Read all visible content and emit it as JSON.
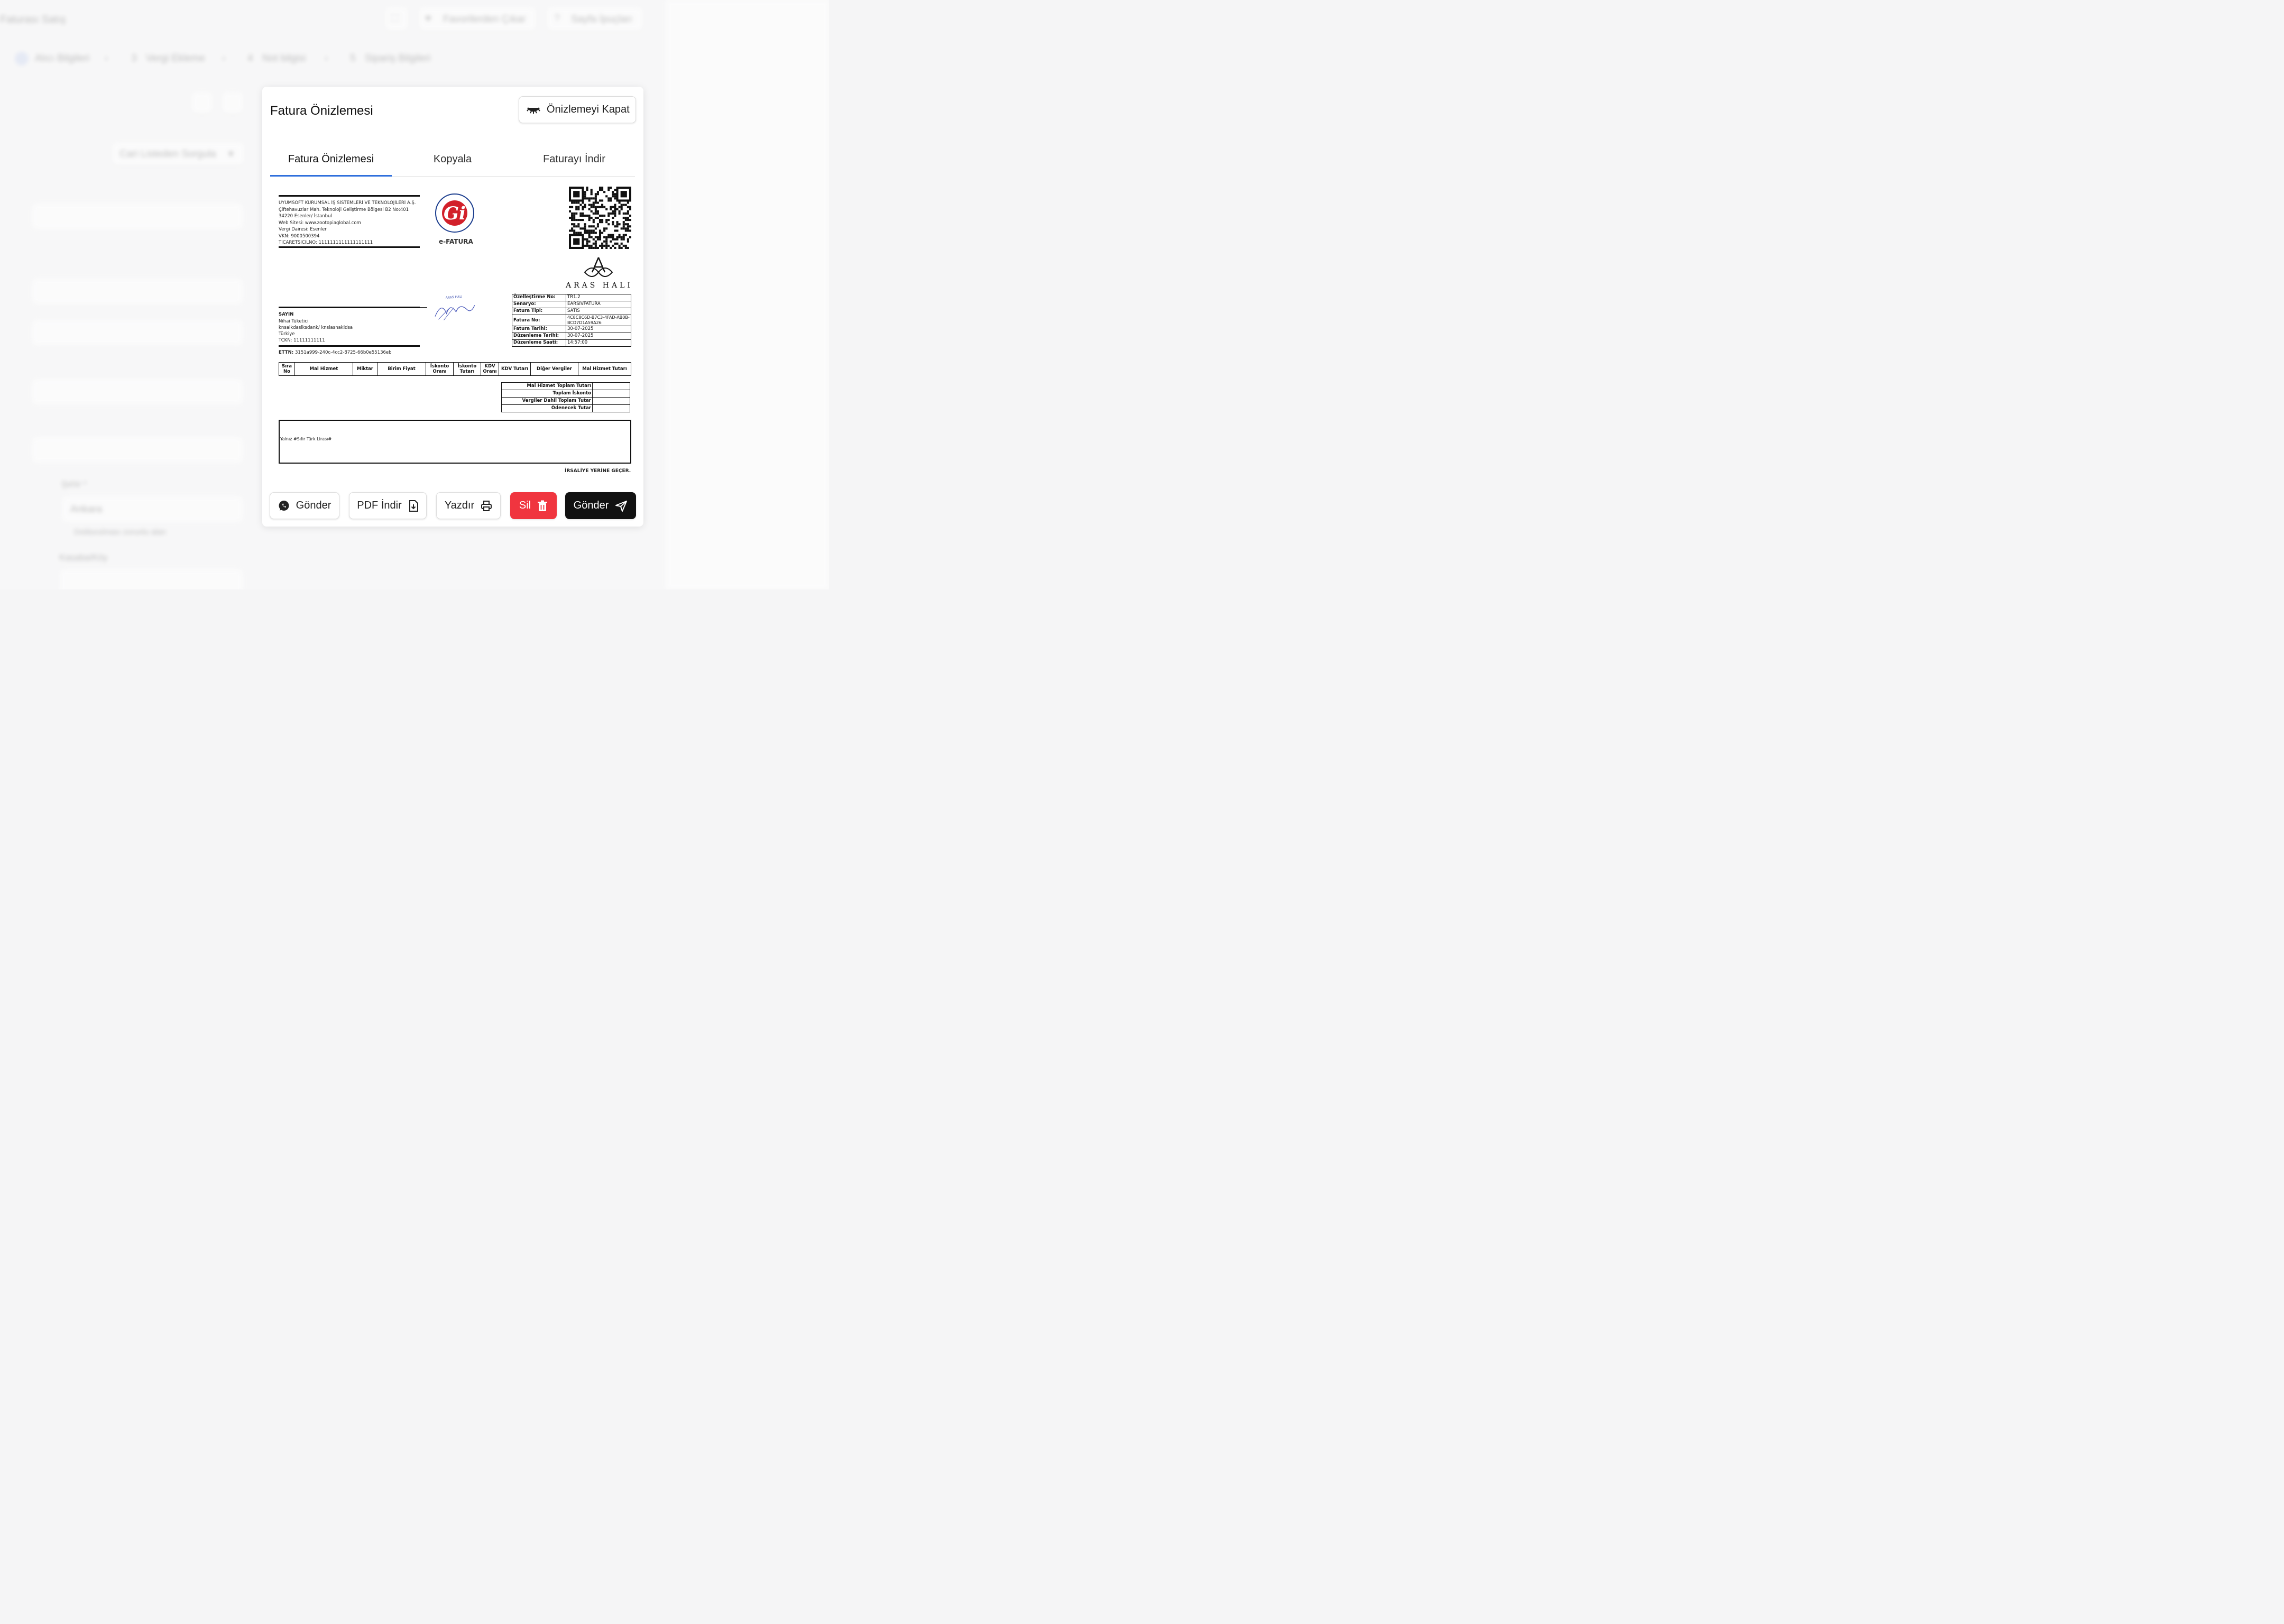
{
  "background": {
    "page_title": "Faturası Satış",
    "fullscreen_icon": "fullscreen-icon",
    "favorite_label": "Favorilerden Çıkar",
    "tips_label": "Sayfa İpuçları",
    "steps": [
      {
        "num": "",
        "label": "Alıcı Bilgileri"
      },
      {
        "num": "3",
        "label": "Vergi Ekleme"
      },
      {
        "num": "4",
        "label": "Not bilgisi"
      },
      {
        "num": "5",
        "label": "Sipariş Bilgileri"
      }
    ],
    "query_button": "Cari Listeden Sorgula",
    "city_label": "Şehir *",
    "city_value": "Ankara",
    "district_label": "Kasaba/Köy",
    "checkbox_label": "Doldurulması zorunlu alan"
  },
  "panel": {
    "title": "Fatura Önizlemesi",
    "close_label": "Önizlemeyi Kapat",
    "tabs": [
      "Fatura Önizlemesi",
      "Kopyala",
      "Faturayı İndir"
    ],
    "active_tab": 0
  },
  "invoice": {
    "seller": [
      "UYUMSOFT KURUMSAL İŞ SİSTEMLERİ VE TEKNOLOJİLERİ A.Ş.",
      "Çiftehavuzlar Mah. Teknoloji Geliştirme Bölgesi B2 No:401",
      "34220 Esenler/ İstanbul",
      "Web Sitesi: www.zootopiaglobal.com",
      "Vergi Dairesi: Esenler",
      "VKN: 9000500394",
      "TICARETSICILNO: 1111111111111111111"
    ],
    "gib_logo_text": "T.C. Hazine ve Maliye Bakanlığı",
    "efatura_label": "e-FATURA",
    "brand": "ARAS HALI",
    "stamp_text": "ARAS HALI",
    "buyer": [
      "SAYIN",
      "Nihai Tüketici",
      "knsalkdaslksdank/ knslasnakldsa",
      "Türkiye",
      "TCKN: 11111111111"
    ],
    "ettn_label": "ETTN:",
    "ettn_value": "3151a999-240c-4cc2-8725-66b0e55136eb",
    "info": [
      {
        "k": "Özelleştirme No:",
        "v": "TR1.2"
      },
      {
        "k": "Senaryo:",
        "v": "EARSIVFATURA"
      },
      {
        "k": "Fatura Tipi:",
        "v": "SATIS"
      },
      {
        "k": "Fatura No:",
        "v": "4C8C8C6D-B7C3-4FAD-AB0B-BCD7D1A59A26"
      },
      {
        "k": "Fatura Tarihi:",
        "v": "30-07-2025"
      },
      {
        "k": "Düzenleme Tarihi:",
        "v": "30-07-2025"
      },
      {
        "k": "Düzenleme Saati:",
        "v": "14:57:00"
      }
    ],
    "columns": [
      "Sıra No",
      "Mal Hizmet",
      "Miktar",
      "Birim Fiyat",
      "İskonto Oranı",
      "İskonto Tutarı",
      "KDV Oranı",
      "KDV Tutarı",
      "Diğer Vergiler",
      "Mal Hizmet Tutarı"
    ],
    "totals": [
      {
        "label": "Mal Hizmet Toplam Tutarı",
        "value": ""
      },
      {
        "label": "Toplam İskonto",
        "value": ""
      },
      {
        "label": "Vergiler Dahil Toplam Tutar",
        "value": ""
      },
      {
        "label": "Ödenecek Tutar",
        "value": ""
      }
    ],
    "note": "Yalnız #Sıfır Türk Lirası#",
    "footer_note": "İRSALİYE YERİNE GEÇER."
  },
  "actions": {
    "whatsapp_send": "Gönder",
    "pdf_download": "PDF İndir",
    "print": "Yazdır",
    "delete": "Sil",
    "send": "Gönder"
  },
  "colors": {
    "accent": "#2f6fdc",
    "danger": "#f0353f",
    "dark": "#111111"
  }
}
